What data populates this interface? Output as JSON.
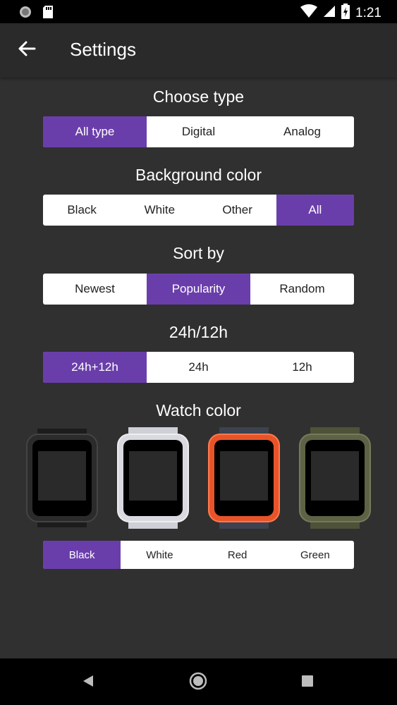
{
  "status": {
    "time": "1:21"
  },
  "appbar": {
    "title": "Settings"
  },
  "sections": {
    "type": {
      "title": "Choose type",
      "options": [
        "All type",
        "Digital",
        "Analog"
      ],
      "selected": "All type"
    },
    "background": {
      "title": "Background color",
      "options": [
        "Black",
        "White",
        "Other",
        "All"
      ],
      "selected": "All"
    },
    "sort": {
      "title": "Sort by",
      "options": [
        "Newest",
        "Popularity",
        "Random"
      ],
      "selected": "Popularity"
    },
    "hours": {
      "title": "24h/12h",
      "options": [
        "24h+12h",
        "24h",
        "12h"
      ],
      "selected": "24h+12h"
    },
    "watch": {
      "title": "Watch color",
      "options": [
        "Black",
        "White",
        "Red",
        "Green"
      ],
      "selected": "Black"
    }
  },
  "colors": {
    "accent": "#6a3eaa",
    "watch_black": "#2b2b2b",
    "watch_white": "#d9d9e0",
    "watch_red": "#e8542a",
    "watch_green": "#5e6346"
  }
}
